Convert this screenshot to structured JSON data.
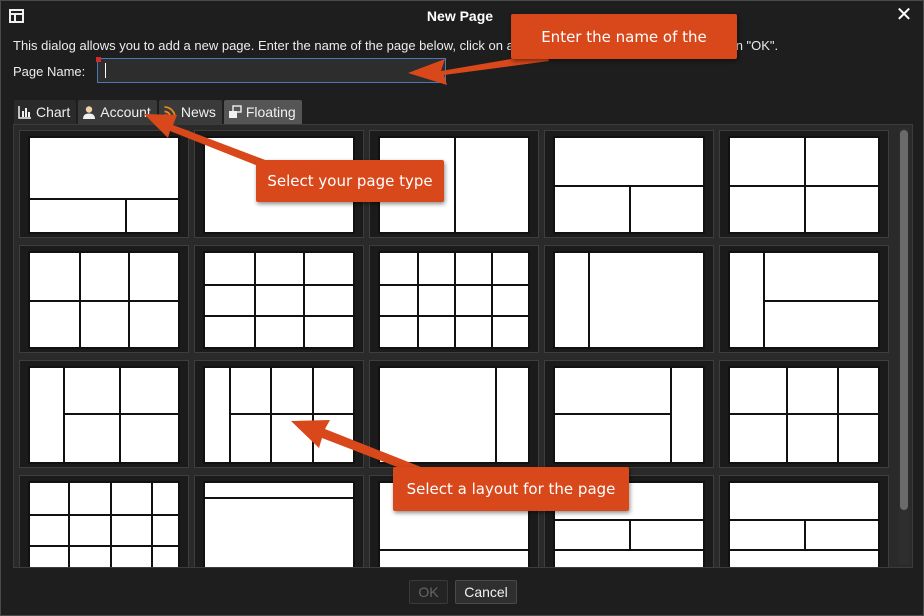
{
  "window": {
    "title": "New Page",
    "intro_text": "This dialog allows you to add a new page.  Enter the name of the page below, click on a page type and layout, and then click on \"OK\".",
    "page_name_label": "Page Name:",
    "page_name_value": ""
  },
  "tabs": [
    {
      "label": "Chart",
      "icon": "bar-chart-icon",
      "active": true
    },
    {
      "label": "Account",
      "icon": "user-icon",
      "active": false
    },
    {
      "label": "News",
      "icon": "rss-icon",
      "active": false
    },
    {
      "label": "Floating",
      "icon": "floating-windows-icon",
      "active": false
    }
  ],
  "footer": {
    "ok_label": "OK",
    "ok_enabled": false,
    "cancel_label": "Cancel"
  },
  "callouts": {
    "name": "Enter the name of the",
    "type": "Select your page type",
    "layout": "Select a layout for the page"
  },
  "colors": {
    "callout": "#d9481b",
    "background": "#1e1e1e",
    "panel": "#2a2a2a",
    "input_border": "#4a78b5"
  }
}
